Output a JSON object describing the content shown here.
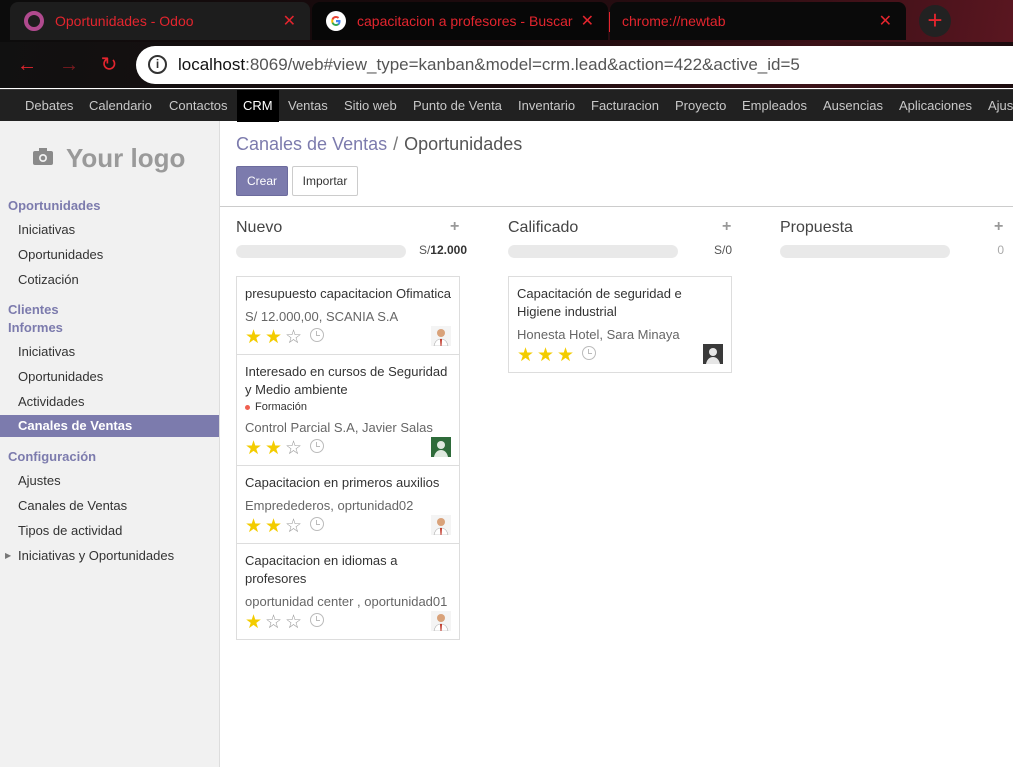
{
  "browser": {
    "tabs": [
      {
        "title": "Oportunidades - Odoo",
        "icon": "odoo-icon"
      },
      {
        "title": "capacitacion a profesores - Buscar",
        "icon": "google-icon"
      },
      {
        "title": "chrome://newtab",
        "icon": ""
      }
    ],
    "new_tab": "+",
    "url_host": "localhost",
    "url_rest": ":8069/web#view_type=kanban&model=crm.lead&action=422&active_id=5",
    "accent": "#e3252e"
  },
  "menu": [
    "Debates",
    "Calendario",
    "Contactos",
    "CRM",
    "Ventas",
    "Sitio web",
    "Punto de Venta",
    "Inventario",
    "Facturacion",
    "Proyecto",
    "Empleados",
    "Ausencias",
    "Aplicaciones",
    "Ajustes"
  ],
  "sidebar": {
    "logo_text": "Your logo",
    "sections": {
      "oportunidades": "Oportunidades",
      "clientes": "Clientes",
      "informes": "Informes",
      "configuracion": "Configuración"
    },
    "items": {
      "iniciativas": "Iniciativas",
      "oportunidades": "Oportunidades",
      "cotizacion": "Cotización",
      "inf_iniciativas": "Iniciativas",
      "inf_oportunidades": "Oportunidades",
      "actividades": "Actividades",
      "canales": "Canales de Ventas",
      "ajustes": "Ajustes",
      "conf_canales": "Canales de Ventas",
      "tipos": "Tipos de actividad",
      "inic_oport": "Iniciativas y Oportunidades"
    }
  },
  "breadcrumb": {
    "parent": "Canales de Ventas",
    "separator": "/",
    "current": "Oportunidades"
  },
  "buttons": {
    "create": "Crear",
    "import": "Importar"
  },
  "columns": [
    {
      "title": "Nuevo",
      "currency": "S/",
      "total": "12.000"
    },
    {
      "title": "Calificado",
      "currency": "S/",
      "total": "0"
    },
    {
      "title": "Propuesta",
      "currency": "",
      "total": "0"
    }
  ],
  "cards": {
    "c1": {
      "title": "presupuesto capacitacion Ofimatica",
      "sub": "S/ 12.000,00, SCANIA S.A",
      "stars": 2
    },
    "c2": {
      "title": "Interesado en cursos de Seguridad y Medio ambiente",
      "tag": "Formación",
      "sub": "Control Parcial S.A, Javier Salas",
      "stars": 2
    },
    "c3": {
      "title": "Capacitacion en primeros auxilios",
      "sub": "Empredederos, oprtunidad02",
      "stars": 2
    },
    "c4": {
      "title": "Capacitacion en idiomas a profesores",
      "sub": "oportunidad center , oportunidad01",
      "stars": 1
    },
    "c5": {
      "title": "Capacitación de seguridad e Higiene industrial",
      "sub": "Honesta Hotel, Sara Minaya",
      "stars": 3
    }
  },
  "colors": {
    "primary": "#7c7bad",
    "star": "#f3cc00",
    "menu_bg": "#212121"
  }
}
